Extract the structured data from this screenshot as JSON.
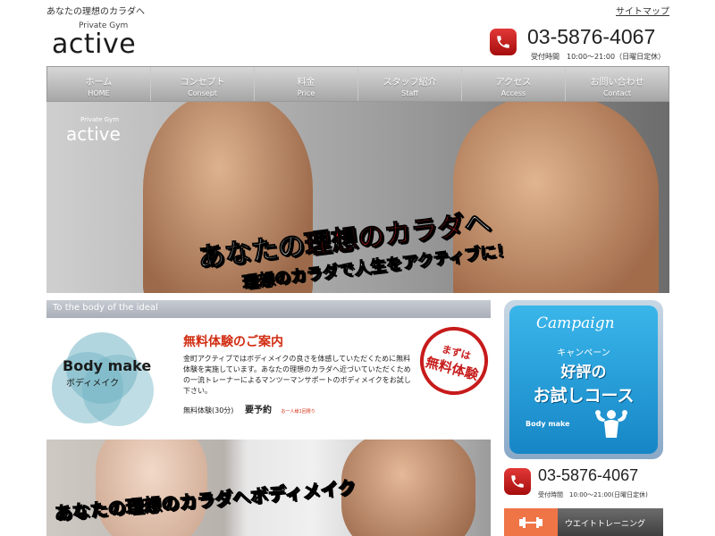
{
  "header": {
    "tagline": "あなたの理想のカラダへ",
    "sitemap": "サイトマップ",
    "logo_small": "Private Gym",
    "logo_big": "active",
    "phone": "03-5876-4067",
    "hours": "受付時間　10:00～21:00（日曜日定休）"
  },
  "nav": {
    "items": [
      {
        "jp": "ホーム",
        "en": "HOME"
      },
      {
        "jp": "コンセプト",
        "en": "Consept"
      },
      {
        "jp": "料金",
        "en": "Price"
      },
      {
        "jp": "スタッフ紹介",
        "en": "Staff"
      },
      {
        "jp": "アクセス",
        "en": "Access"
      },
      {
        "jp": "お問い合わせ",
        "en": "Contact"
      }
    ]
  },
  "hero": {
    "brand_small": "Private Gym",
    "brand_big": "active",
    "headline_a": "あなたの",
    "headline_b": "理想のカラダ",
    "headline_c": "へ",
    "sub": "理想のカラダで人生をアクティブに！"
  },
  "section": {
    "bar": "To the body of the ideal",
    "bodymake_en": "Body make",
    "bodymake_jp": "ボディメイク",
    "trial_title": "無料体験のご案内",
    "trial_text": "金町アクティブではボディメイクの良さを体感していただくために無料体験を実施しています。あなたの理想のカラダへ近づいていただくための一流トレーナーによるマンツーマンサポートのボディメイクをお試し下さい。",
    "trial_label": "無料体験(30分)",
    "trial_req": "要予約",
    "trial_note": "お一人様1回限り",
    "stamp_a": "まずは",
    "stamp_b": "無料体験"
  },
  "bottom": {
    "a": "あなたの",
    "b": "理想のカラダ",
    "c": "へボディメイク"
  },
  "sidebar": {
    "campaign_title": "Campaign",
    "campaign_kana": "キャンペーン",
    "campaign_l1": "好評の",
    "campaign_l2": "お試しコース",
    "campaign_tag": "Body make",
    "phone": "03-5876-4067",
    "hours": "受付時間　10:00～21:00(日曜日定休)",
    "weight_label": "ウエイトトレーニング"
  }
}
